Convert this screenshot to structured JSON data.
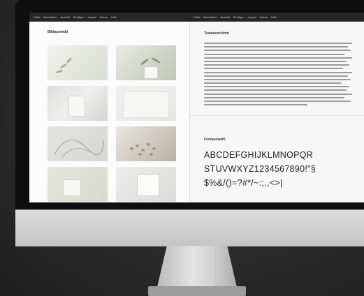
{
  "menu": {
    "left_items": [
      "Datei",
      "Bearbeiten",
      "Ansicht",
      "Einfügen",
      "Layout",
      "Extras",
      "Hilfe"
    ],
    "right_items": [
      "Datei",
      "Bearbeiten",
      "Ansicht",
      "Einfügen",
      "Layout",
      "Extras",
      "Hilfe"
    ]
  },
  "left_pane": {
    "title": "Bildauswahl",
    "thumbnails": [
      {
        "name": "plant-leaves-photo",
        "icon": "plant-icon"
      },
      {
        "name": "potted-plant-photo",
        "icon": "plant-icon"
      },
      {
        "name": "white-cup-photo",
        "icon": "cup-icon"
      },
      {
        "name": "blank-paper-photo",
        "icon": "paper-icon"
      },
      {
        "name": "sketch-lines-photo",
        "icon": "sketch-icon"
      },
      {
        "name": "pebbles-photo",
        "icon": "pebbles-icon"
      },
      {
        "name": "mug-photo",
        "icon": "cup-icon"
      },
      {
        "name": "frame-photo",
        "icon": "frame-icon"
      }
    ]
  },
  "right_pane": {
    "text_title": "Textauszeichnt",
    "font_title": "Fontauswahl",
    "glyph_lines": [
      "ABCDEFGHIJKLMNOPQR",
      "STUVWXYZ1234567890!\"§",
      "$%&/()=?#*/~:;.,<>|"
    ]
  },
  "colors": {
    "background": "#2b2b2b",
    "screen_bg": "#fbfbfb",
    "menubar": "#262626",
    "stand": "#cfcfcf"
  }
}
